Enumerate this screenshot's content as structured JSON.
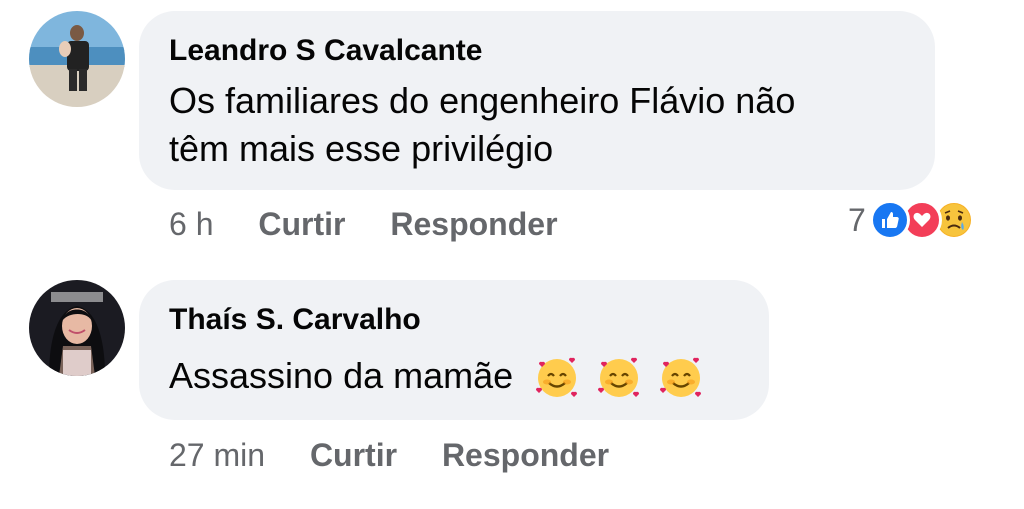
{
  "comments": [
    {
      "author": "Leandro S Cavalcante",
      "text_line1": "Os familiares do engenheiro Flávio não",
      "text_line2": "têm mais esse privilégio",
      "time": "6 h",
      "like_label": "Curtir",
      "reply_label": "Responder",
      "reaction_count": "7",
      "reactions": [
        "like-icon",
        "love-icon",
        "sad-icon"
      ]
    },
    {
      "author": "Thaís S. Carvalho",
      "text": "Assassino da mamãe",
      "emojis": [
        "smiling-face-with-hearts-icon",
        "smiling-face-with-hearts-icon",
        "smiling-face-with-hearts-icon"
      ],
      "time": "27 min",
      "like_label": "Curtir",
      "reply_label": "Responder"
    }
  ],
  "colors": {
    "bubble": "#f0f2f5",
    "meta_text": "#65676b",
    "like_blue": "#1877f2",
    "love_red": "#f33e58",
    "sad_yellow": "#f7b125"
  }
}
